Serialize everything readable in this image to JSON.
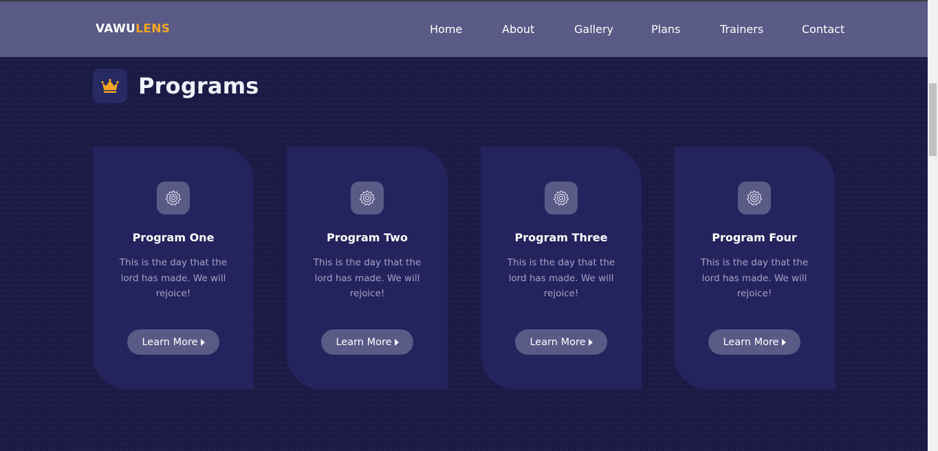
{
  "logo": {
    "part1": "VAWU",
    "part2": "LENS"
  },
  "nav": {
    "items": [
      {
        "label": "Home"
      },
      {
        "label": "About"
      },
      {
        "label": "Gallery"
      },
      {
        "label": "Plans"
      },
      {
        "label": "Trainers"
      },
      {
        "label": "Contact"
      }
    ]
  },
  "section": {
    "title": "Programs",
    "icon": "crown-icon"
  },
  "programs": [
    {
      "title": "Program One",
      "description": "This is the day that the lord has made. We will rejoice!",
      "button": "Learn More",
      "icon": "gear-icon"
    },
    {
      "title": "Program Two",
      "description": "This is the day that the lord has made. We will rejoice!",
      "button": "Learn More",
      "icon": "gear-icon"
    },
    {
      "title": "Program Three",
      "description": "This is the day that the lord has made. We will rejoice!",
      "button": "Learn More",
      "icon": "gear-icon"
    },
    {
      "title": "Program Four",
      "description": "This is the day that the lord has made. We will rejoice!",
      "button": "Learn More",
      "icon": "gear-icon"
    }
  ],
  "colors": {
    "background": "#1a1a45",
    "navbar": "#595a86",
    "card": "#24235e",
    "accent": "#f5a623",
    "button": "#595a86"
  }
}
